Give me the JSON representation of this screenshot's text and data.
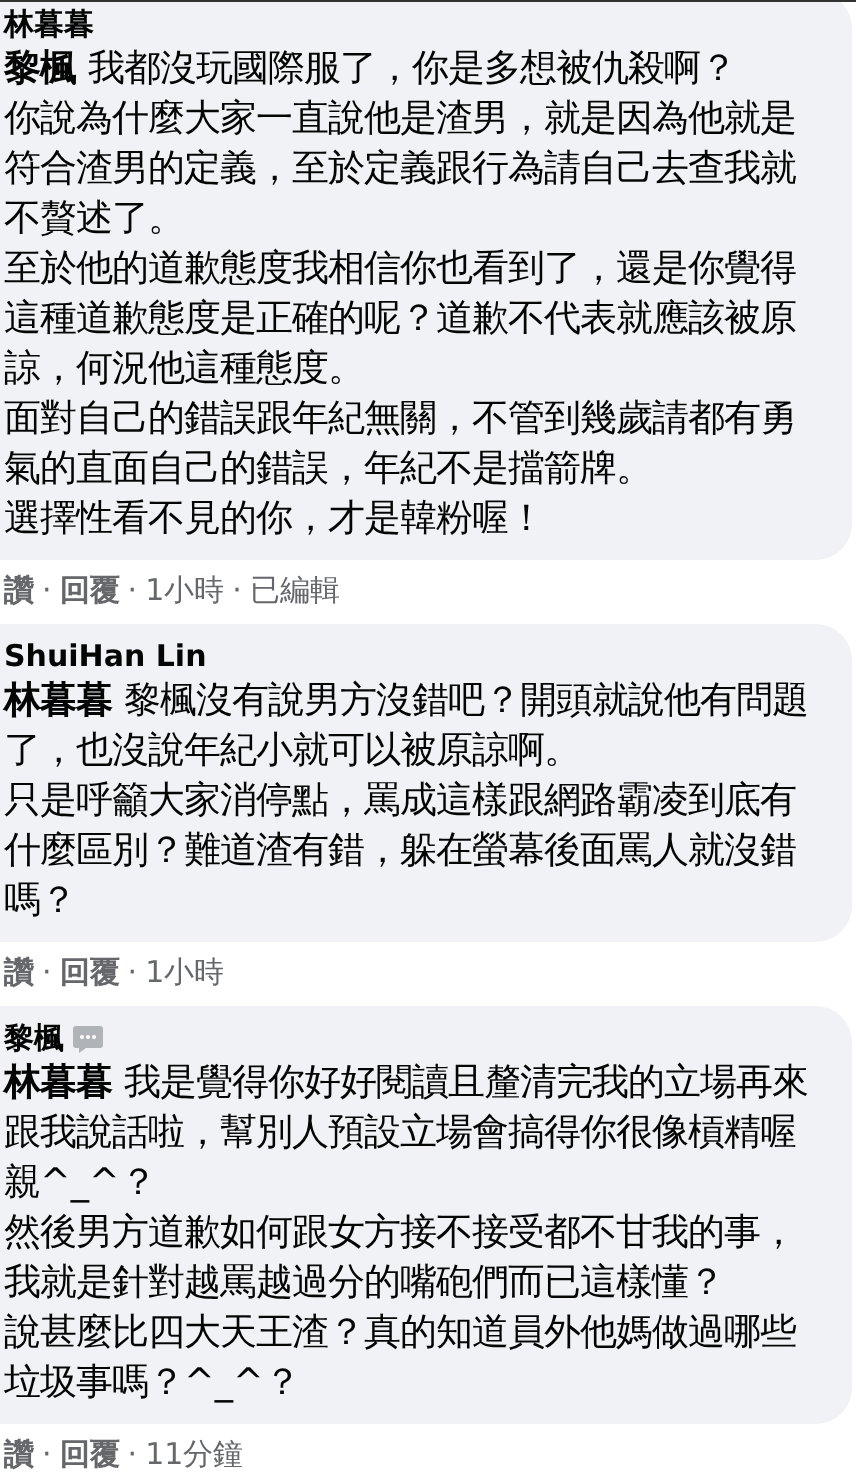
{
  "separator": "·",
  "comments": [
    {
      "author": "林暮暮",
      "author_badge": false,
      "paragraphs": [
        "**黎楓** 我都沒玩國際服了，你是多想被仇殺啊？",
        "你說為什麼大家一直說他是渣男，就是因為他就是符合渣男的定義，至於定義跟行為請自己去查我就不贅述了。",
        "至於他的道歉態度我相信你也看到了，還是你覺得這種道歉態度是正確的呢？道歉不代表就應該被原諒，何況他這種態度。",
        "面對自己的錯誤跟年紀無關，不管到幾歲請都有勇氣的直面自己的錯誤，年紀不是擋箭牌。",
        "選擇性看不見的你，才是韓粉喔！"
      ],
      "actions": [
        "讚",
        "回覆"
      ],
      "time": "1小時",
      "edited": "已編輯"
    },
    {
      "author": "ShuiHan Lin",
      "author_badge": false,
      "paragraphs": [
        "**林暮暮** 黎楓沒有說男方沒錯吧？開頭就說他有問題了，也沒說年紀小就可以被原諒啊。",
        "只是呼籲大家消停點，罵成這樣跟網路霸凌到底有什麼區別？難道渣有錯，躲在螢幕後面罵人就沒錯嗎？"
      ],
      "actions": [
        "讚",
        "回覆"
      ],
      "time": "1小時"
    },
    {
      "author": "黎楓",
      "author_badge": true,
      "paragraphs": [
        "**林暮暮** 我是覺得你好好閱讀且釐清完我的立場再來跟我說話啦，幫別人預設立場會搞得你很像槓精喔親^_^？",
        "然後男方道歉如何跟女方接不接受都不甘我的事，",
        "我就是針對越罵越過分的嘴砲們而已這樣懂？",
        "說甚麼比四大天王渣？真的知道員外他媽做過哪些垃圾事嗎？^_^？"
      ],
      "actions": [
        "讚",
        "回覆"
      ],
      "time": "11分鐘"
    }
  ]
}
